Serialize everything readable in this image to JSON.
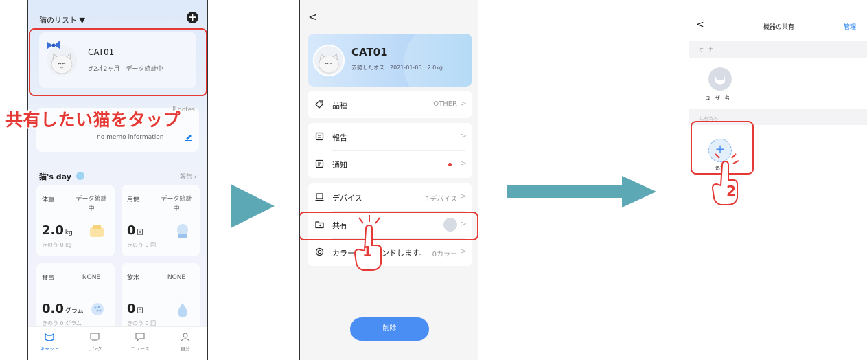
{
  "colors": {
    "accent_red": "#e53935",
    "brand_blue": "#1e7ff0",
    "arrow_teal": "#5ca8b5",
    "delete_blue": "#4a8ef3"
  },
  "phone1": {
    "header_title": "猫のリスト ▼",
    "cat": {
      "name": "CAT01",
      "subtitle": "♂2才2ヶ月　データ統計中"
    },
    "caption": "共有したい猫をタップ",
    "notes_link": "ll notes",
    "memo": "no memo information",
    "day_title": "猫's day",
    "day_link": "報告",
    "tiles": [
      {
        "name": "体重",
        "status": "データ統計中",
        "value": "2.0",
        "unit": "kg",
        "sub": "きのう 0 kg"
      },
      {
        "name": "用便",
        "status": "データ統計中",
        "value": "0",
        "unit": "回",
        "sub": "きのう 0 回"
      },
      {
        "name": "食事",
        "status": "NONE",
        "value": "0.0",
        "unit": "グラム",
        "sub": "きのう 0 グラム"
      },
      {
        "name": "飲水",
        "status": "NONE",
        "value": "0",
        "unit": "回",
        "sub": "きのう 0 回"
      }
    ],
    "tabs": [
      {
        "label": "キャット",
        "icon": "cat-icon"
      },
      {
        "label": "リンク",
        "icon": "device-icon"
      },
      {
        "label": "ニュース",
        "icon": "message-icon"
      },
      {
        "label": "自分",
        "icon": "user-icon"
      }
    ]
  },
  "phone2": {
    "back": "<",
    "cat": {
      "name": "CAT01",
      "subtitle": "去勢したオス　2021-01-05　2.0kg"
    },
    "rows": {
      "breed": {
        "label": "品種",
        "value": "OTHER"
      },
      "report": {
        "label": "報告"
      },
      "notify": {
        "label": "通知"
      },
      "device": {
        "label": "デバイス",
        "value": "1デバイス"
      },
      "share": {
        "label": "共有"
      },
      "color": {
        "label": "カラー",
        "label_tail": "ンドします。",
        "value": "0カラー"
      }
    },
    "chevron": ">",
    "step": "1",
    "delete_label": "削除"
  },
  "phone3": {
    "back": "<",
    "title": "機器の共有",
    "manage": "管理",
    "owner_section": "オーナー",
    "user_name": "ユーザー名",
    "shared_section": "共有済み",
    "add_label": "追加",
    "step": "2"
  }
}
